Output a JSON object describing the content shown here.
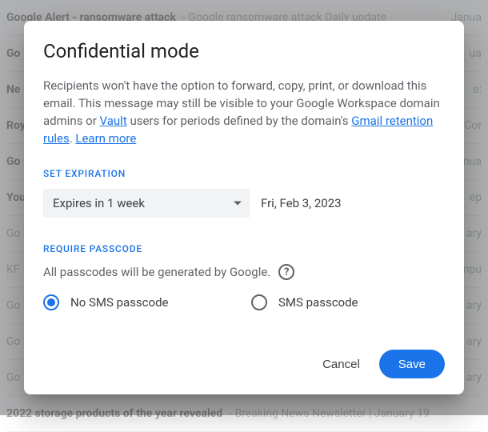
{
  "dialog": {
    "title": "Confidential mode",
    "description_parts": {
      "p1": "Recipients won't have the option to forward, copy, print, or download this email. This message may still be visible to your Google Workspace domain admins or ",
      "link_vault": "Vault",
      "p2": " users for periods defined by the domain's ",
      "link_rules": "Gmail retention rules",
      "p3": ". ",
      "link_learn": "Learn more"
    },
    "expiration": {
      "label": "SET EXPIRATION",
      "selected": "Expires in 1 week",
      "date": "Fri, Feb 3, 2023"
    },
    "passcode": {
      "label": "REQUIRE PASSCODE",
      "note": "All passcodes will be generated by Google.",
      "option_no_sms": "No SMS passcode",
      "option_sms": "SMS passcode"
    },
    "actions": {
      "cancel": "Cancel",
      "save": "Save"
    }
  },
  "background_emails": [
    {
      "sender": "Google Alert - ransomware attack",
      "subject": "- Google ransomware attack Daily update",
      "date": "Janua",
      "unread": true
    },
    {
      "sender": "Go",
      "subject": "",
      "date": "ua",
      "unread": true
    },
    {
      "sender": "Ne",
      "subject": "",
      "date": "e:",
      "unread": true
    },
    {
      "sender": "Roy",
      "subject": "",
      "date": "Cor",
      "unread": true
    },
    {
      "sender": "Go",
      "subject": "",
      "date": "nua",
      "unread": true
    },
    {
      "sender": "You",
      "subject": "",
      "date": "ep",
      "unread": true
    },
    {
      "sender": "Go",
      "subject": "",
      "date": "ary",
      "unread": false
    },
    {
      "sender": "KF",
      "subject": "",
      "date": "npu",
      "unread": false
    },
    {
      "sender": "Go",
      "subject": "",
      "date": "ary",
      "unread": false
    },
    {
      "sender": "Go",
      "subject": "",
      "date": "ary",
      "unread": false
    },
    {
      "sender": "Go",
      "subject": "",
      "date": "ary",
      "unread": false
    },
    {
      "sender": "2022 storage products of the year revealed",
      "subject": "- Breaking News Newsletter | January 19",
      "date": "",
      "unread": true
    }
  ]
}
